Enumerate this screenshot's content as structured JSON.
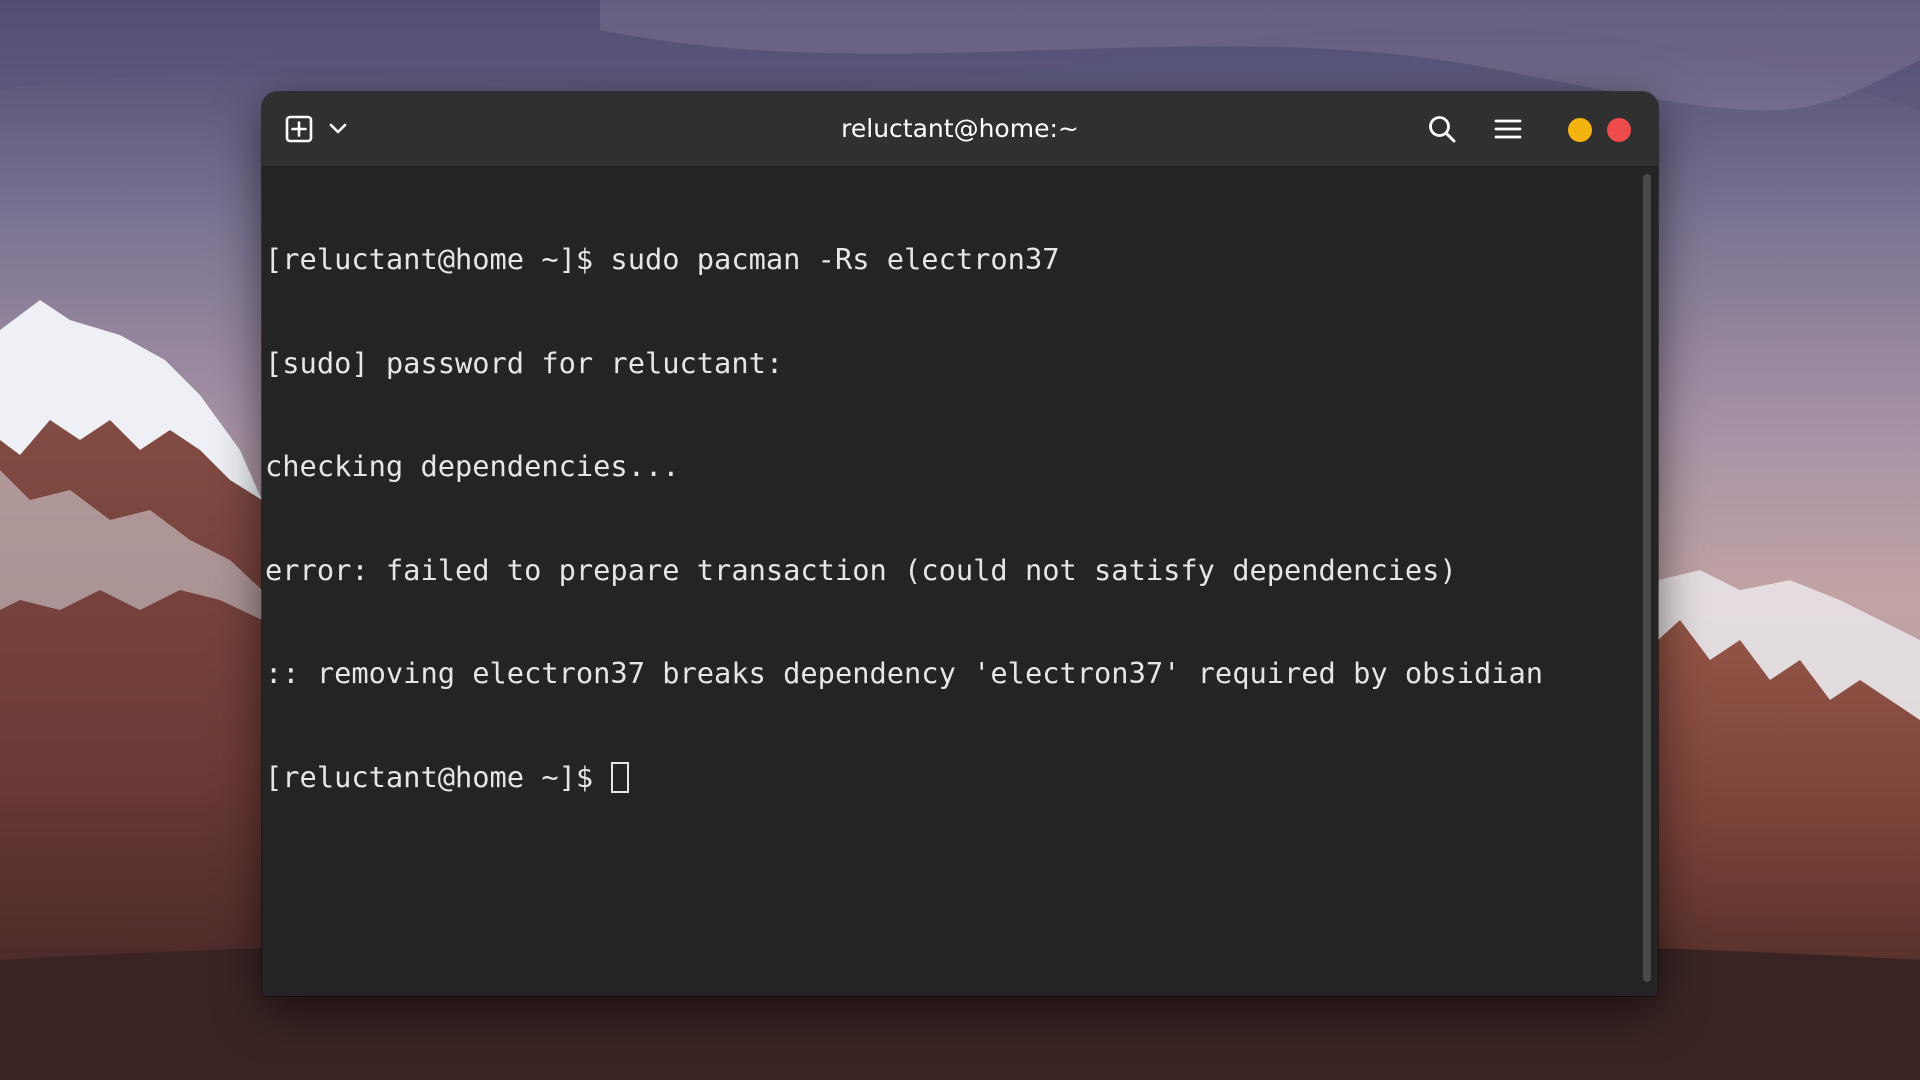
{
  "window": {
    "title": "reluctant@home:~"
  },
  "headerbar": {
    "new_tab_icon": "new-tab-plus-icon",
    "tab_menu_icon": "chevron-down-icon",
    "search_icon": "search-icon",
    "menu_icon": "hamburger-menu-icon"
  },
  "window_controls": {
    "minimize_color": "#f5b30f",
    "close_color": "#ee4b4b"
  },
  "terminal": {
    "lines": [
      "[reluctant@home ~]$ sudo pacman -Rs electron37",
      "[sudo] password for reluctant:",
      "checking dependencies...",
      "error: failed to prepare transaction (could not satisfy dependencies)",
      ":: removing electron37 breaks dependency 'electron37' required by obsidian"
    ],
    "prompt": "[reluctant@home ~]$ "
  },
  "colors": {
    "terminal_background": "#242424",
    "headerbar_background": "#303030",
    "text": "#e6e6e6"
  }
}
